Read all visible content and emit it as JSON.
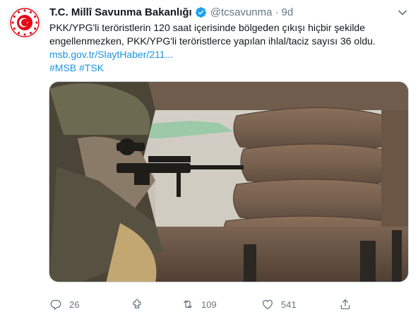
{
  "account": {
    "name": "T.C. Millî Savunma Bakanlığı",
    "handle": "@tcsavunma",
    "separator": "·",
    "time": "9d",
    "verified": true
  },
  "tweet": {
    "line1": "PKK/YPG'li teröristlerin 120 saat içerisinde bölgeden çıkışı hiçbir şekilde",
    "line2": "engellenmezken, PKK/YPG'li teröristlerce yapılan ihlal/taciz sayısı 36 oldu.",
    "link": "msb.gov.tr/SlaytHaber/211...",
    "hashtags": "#MSB #TSK"
  },
  "media": {
    "description_icon": "photo-soldier-sandbags"
  },
  "actions": {
    "replies": "26",
    "retweets": "109",
    "likes": "541"
  },
  "colors": {
    "link": "#1b95e0",
    "secondary": "#657786",
    "verified": "#1da1f2",
    "logo_red": "#e30a17"
  }
}
